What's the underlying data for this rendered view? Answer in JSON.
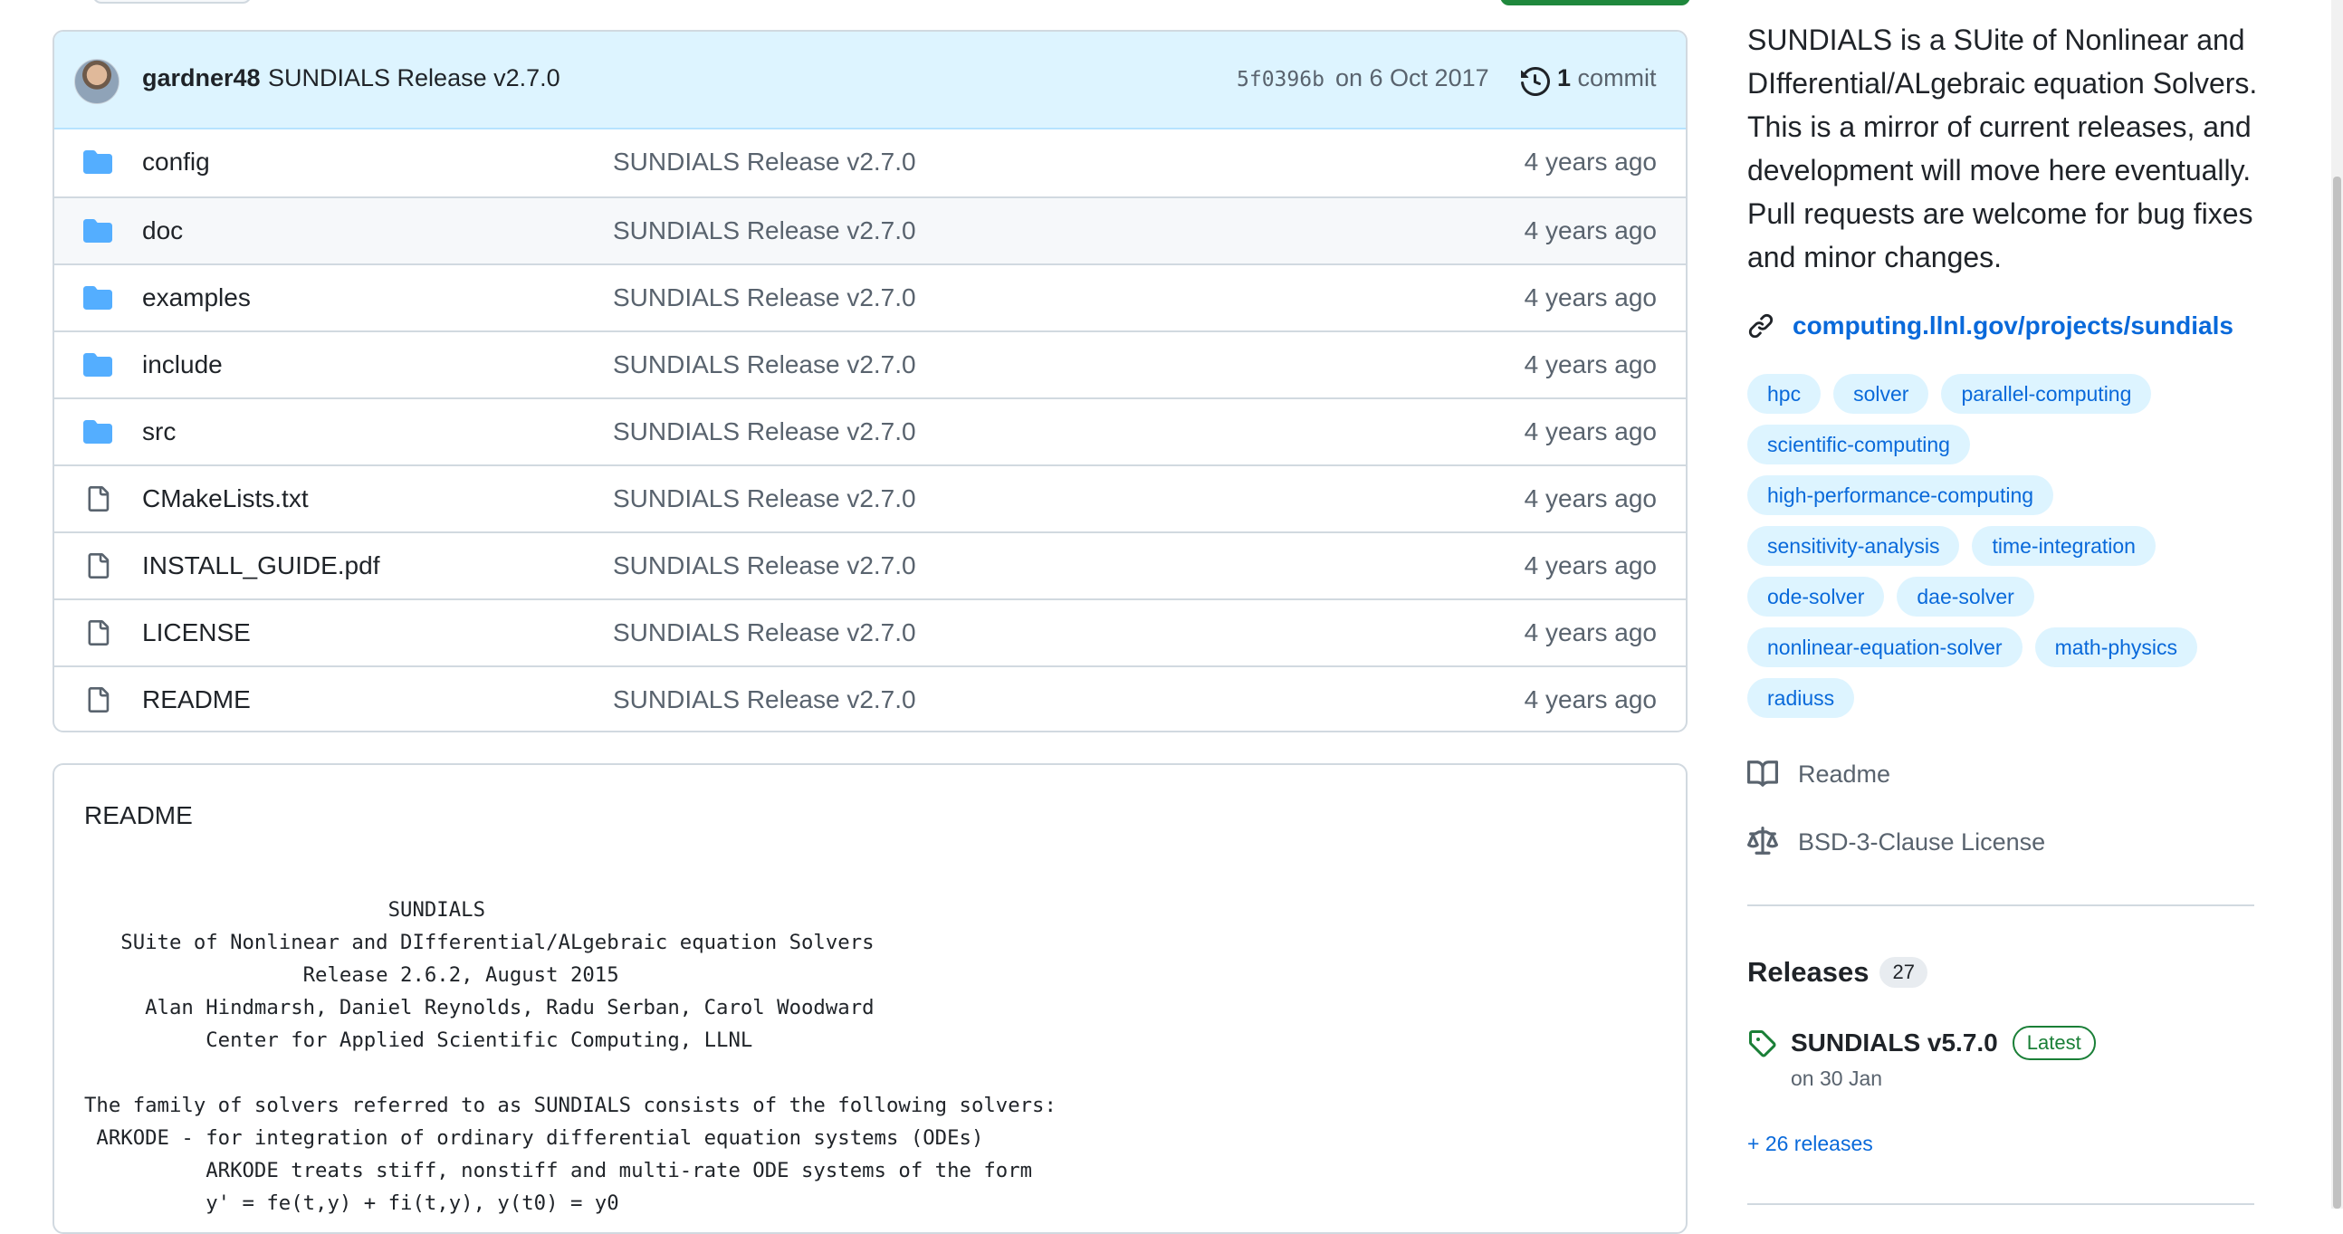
{
  "commit": {
    "author": "gardner48",
    "message": "SUNDIALS Release v2.7.0",
    "sha": "5f0396b",
    "date": "on 6 Oct 2017",
    "count": "1",
    "count_label": "commit"
  },
  "files": [
    {
      "name": "config",
      "type": "dir",
      "commit": "SUNDIALS Release v2.7.0",
      "age": "4 years ago"
    },
    {
      "name": "doc",
      "type": "dir",
      "commit": "SUNDIALS Release v2.7.0",
      "age": "4 years ago"
    },
    {
      "name": "examples",
      "type": "dir",
      "commit": "SUNDIALS Release v2.7.0",
      "age": "4 years ago"
    },
    {
      "name": "include",
      "type": "dir",
      "commit": "SUNDIALS Release v2.7.0",
      "age": "4 years ago"
    },
    {
      "name": "src",
      "type": "dir",
      "commit": "SUNDIALS Release v2.7.0",
      "age": "4 years ago"
    },
    {
      "name": "CMakeLists.txt",
      "type": "file",
      "commit": "SUNDIALS Release v2.7.0",
      "age": "4 years ago"
    },
    {
      "name": "INSTALL_GUIDE.pdf",
      "type": "file",
      "commit": "SUNDIALS Release v2.7.0",
      "age": "4 years ago"
    },
    {
      "name": "LICENSE",
      "type": "file",
      "commit": "SUNDIALS Release v2.7.0",
      "age": "4 years ago"
    },
    {
      "name": "README",
      "type": "file",
      "commit": "SUNDIALS Release v2.7.0",
      "age": "4 years ago"
    }
  ],
  "readme": {
    "title": "README",
    "lines": [
      "                         SUNDIALS",
      "   SUite of Nonlinear and DIfferential/ALgebraic equation Solvers",
      "                  Release 2.6.2, August 2015",
      "     Alan Hindmarsh, Daniel Reynolds, Radu Serban, Carol Woodward",
      "          Center for Applied Scientific Computing, LLNL",
      "",
      "The family of solvers referred to as SUNDIALS consists of the following solvers:",
      " ARKODE - for integration of ordinary differential equation systems (ODEs)",
      "          ARKODE treats stiff, nonstiff and multi-rate ODE systems of the form",
      "          y' = fe(t,y) + fi(t,y), y(t0) = y0"
    ]
  },
  "about": {
    "description": "SUNDIALS is a SUite of Nonlinear and DIfferential/ALgebraic equation Solvers. This is a mirror of current releases, and development will move here eventually. Pull requests are welcome for bug fixes and minor changes.",
    "link": "computing.llnl.gov/projects/sundials",
    "topics": [
      "hpc",
      "solver",
      "parallel-computing",
      "scientific-computing",
      "high-performance-computing",
      "sensitivity-analysis",
      "time-integration",
      "ode-solver",
      "dae-solver",
      "nonlinear-equation-solver",
      "math-physics",
      "radiuss"
    ],
    "readme_label": "Readme",
    "license_label": "BSD-3-Clause License"
  },
  "releases": {
    "title": "Releases",
    "count": "27",
    "latest_name": "SUNDIALS v5.7.0",
    "latest_badge": "Latest",
    "latest_date": "on 30 Jan",
    "more": "+ 26 releases"
  },
  "colors": {
    "accent": "#0969da",
    "folder": "#54aeff",
    "latest": "#1a7f37",
    "commit_bar": "#ddf4ff"
  }
}
